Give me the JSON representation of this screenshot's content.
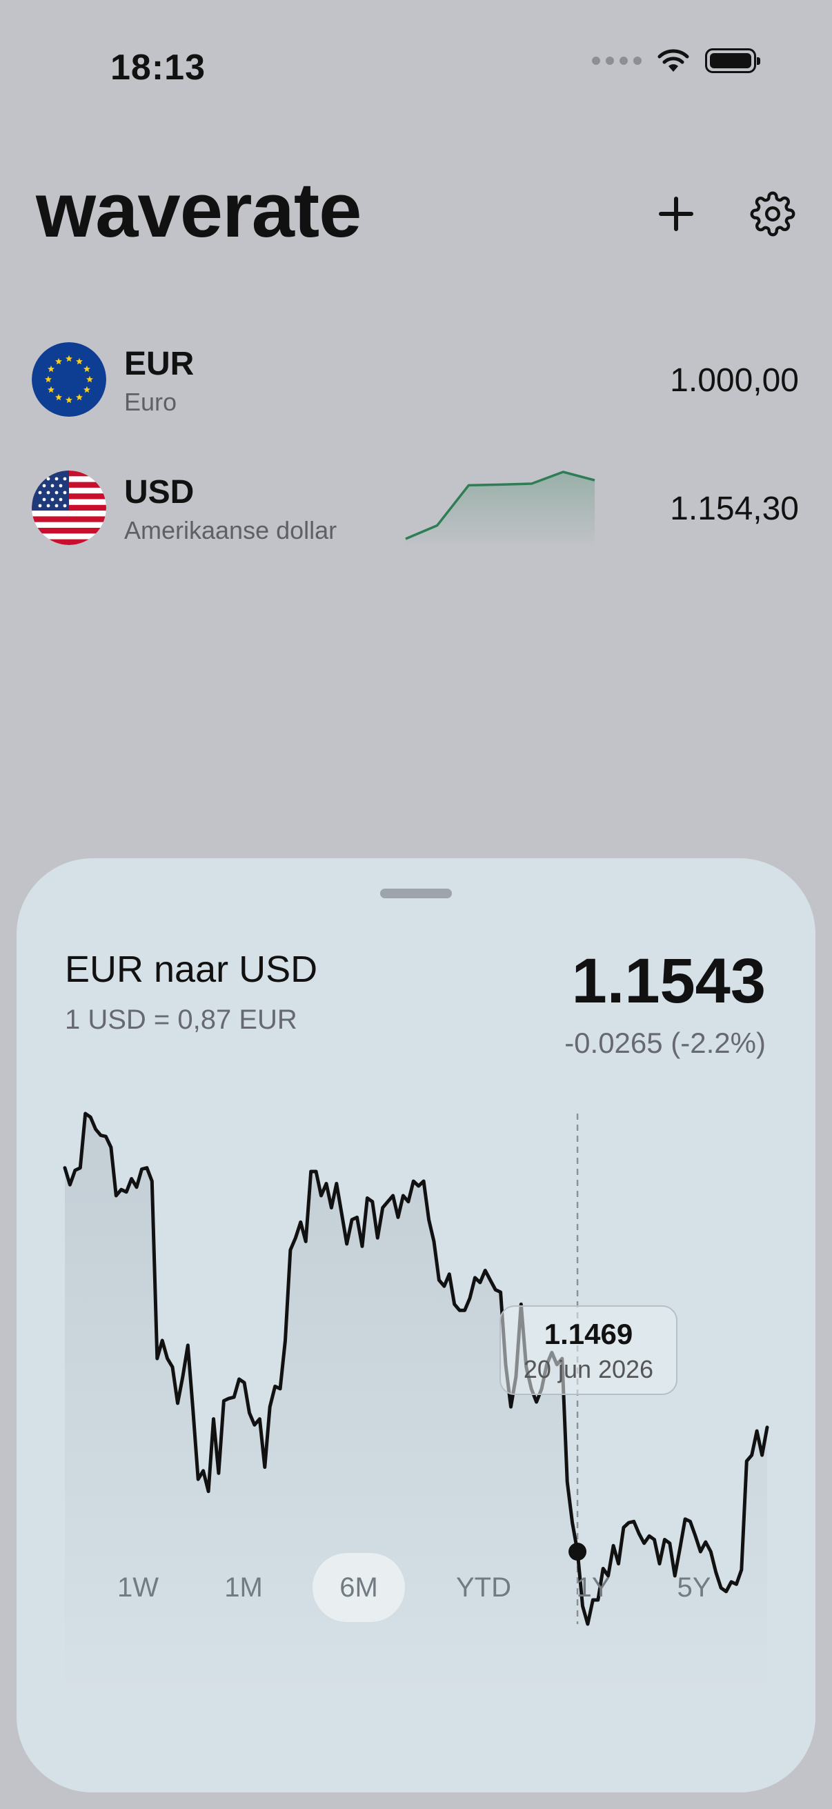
{
  "status_bar": {
    "time": "18:13",
    "icons": [
      "signal-dots-icon",
      "wifi-icon",
      "battery-icon"
    ]
  },
  "header": {
    "title": "waverate",
    "add_icon": "plus-icon",
    "settings_icon": "gear-icon"
  },
  "currencies": [
    {
      "code": "EUR",
      "name": "Euro",
      "amount": "1.000,00",
      "flag": "eu-flag-icon"
    },
    {
      "code": "USD",
      "name": "Amerikaanse dollar",
      "amount": "1.154,30",
      "flag": "us-flag-icon",
      "sparkline": {
        "values": [
          1.132,
          1.136,
          1.148,
          1.1482,
          1.1485,
          1.152,
          1.1495
        ],
        "color": "#2e7d55"
      }
    }
  ],
  "detail": {
    "title": "EUR naar USD",
    "subtitle": "1 USD = 0,87 EUR",
    "rate": "1.1543",
    "change": "-0.0265 (-2.2%)",
    "tooltip": {
      "value": "1.1469",
      "date": "20 jun 2026"
    },
    "ranges": [
      "1W",
      "1M",
      "6M",
      "YTD",
      "1Y",
      "5Y"
    ],
    "active_range": "6M"
  },
  "chart_data": {
    "type": "line",
    "series": [
      {
        "values": [
          1.1763,
          1.1749,
          1.1761,
          1.1763,
          1.1808,
          1.1805,
          1.1795,
          1.179,
          1.1789,
          1.178,
          1.174,
          1.1745,
          1.1743,
          1.1754,
          1.1747,
          1.1762,
          1.1763,
          1.1752,
          1.1605,
          1.162,
          1.1605,
          1.1598,
          1.1568,
          1.159,
          1.1616,
          1.1562,
          1.1505,
          1.1512,
          1.1495,
          1.1555,
          1.151,
          1.157,
          1.1572,
          1.1573,
          1.1588,
          1.1585,
          1.156,
          1.155,
          1.1555,
          1.1515,
          1.1565,
          1.1582,
          1.158,
          1.162,
          1.1695,
          1.1705,
          1.1718,
          1.1702,
          1.176,
          1.176,
          1.174,
          1.175,
          1.173,
          1.175,
          1.1725,
          1.17,
          1.172,
          1.1722,
          1.1698,
          1.1738,
          1.1735,
          1.1705,
          1.173,
          1.1735,
          1.174,
          1.1722,
          1.174,
          1.1735,
          1.1752,
          1.1748,
          1.1752,
          1.172,
          1.1702,
          1.167,
          1.1665,
          1.1675,
          1.165,
          1.1645,
          1.1645,
          1.1655,
          1.1672,
          1.1668,
          1.1678,
          1.167,
          1.1662,
          1.166,
          1.16,
          1.1565,
          1.159,
          1.165,
          1.1598,
          1.158,
          1.1569,
          1.158,
          1.16,
          1.161,
          1.16,
          1.1605,
          1.1503,
          1.1469,
          1.1445,
          1.14,
          1.1385,
          1.1405,
          1.1405,
          1.1431,
          1.1425,
          1.145,
          1.1435,
          1.1465,
          1.1469,
          1.147,
          1.146,
          1.1452,
          1.1458,
          1.1455,
          1.1435,
          1.1455,
          1.1452,
          1.1425,
          1.1448,
          1.1472,
          1.147,
          1.1458,
          1.1445,
          1.1453,
          1.1445,
          1.1428,
          1.1415,
          1.1412,
          1.142,
          1.1418,
          1.143,
          1.152,
          1.1525,
          1.1545,
          1.1525,
          1.1548
        ]
      }
    ],
    "cursor_index": 100,
    "grid": false
  }
}
